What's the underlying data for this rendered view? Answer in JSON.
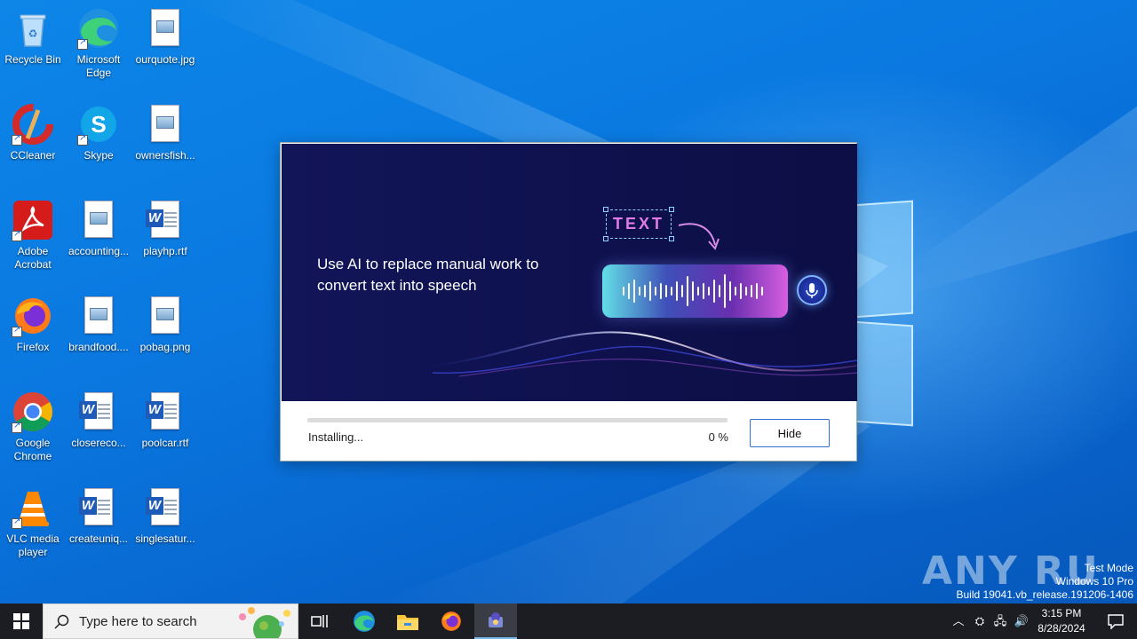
{
  "desktop": {
    "icons": [
      {
        "label": "Recycle Bin",
        "icon": "recycle-bin-icon"
      },
      {
        "label": "Microsoft Edge",
        "icon": "edge-icon"
      },
      {
        "label": "ourquote.jpg",
        "icon": "image-file-icon"
      },
      {
        "label": "CCleaner",
        "icon": "ccleaner-icon"
      },
      {
        "label": "Skype",
        "icon": "skype-icon"
      },
      {
        "label": "ownersfish...",
        "icon": "image-file-icon"
      },
      {
        "label": "Adobe Acrobat",
        "icon": "adobe-acrobat-icon"
      },
      {
        "label": "accounting...",
        "icon": "image-file-icon"
      },
      {
        "label": "playhp.rtf",
        "icon": "word-document-icon"
      },
      {
        "label": "Firefox",
        "icon": "firefox-icon"
      },
      {
        "label": "brandfood....",
        "icon": "image-file-icon"
      },
      {
        "label": "pobag.png",
        "icon": "image-file-icon"
      },
      {
        "label": "Google Chrome",
        "icon": "chrome-icon"
      },
      {
        "label": "closereco...",
        "icon": "word-document-icon"
      },
      {
        "label": "poolcar.rtf",
        "icon": "word-document-icon"
      },
      {
        "label": "VLC media player",
        "icon": "vlc-icon"
      },
      {
        "label": "createuniq...",
        "icon": "word-document-icon"
      },
      {
        "label": "singlesatur...",
        "icon": "word-document-icon"
      }
    ]
  },
  "installer": {
    "tagline": "Use AI to replace manual work to convert text into speech",
    "text_badge": "TEXT",
    "status": "Installing...",
    "percent_label": "0 %",
    "progress": 0,
    "hide_label": "Hide"
  },
  "watermark": {
    "brand": "ANY RUN",
    "line1": "Test Mode",
    "line2": "Windows 10 Pro",
    "line3": "Build 19041.vb_release.191206-1406"
  },
  "taskbar": {
    "search_placeholder": "Type here to search",
    "time": "3:15 PM",
    "date": "8/28/2024"
  },
  "colors": {
    "accent": "#2f6fd6",
    "desktop_blue": "#0a78e0",
    "taskbar": "#1b1d22"
  }
}
